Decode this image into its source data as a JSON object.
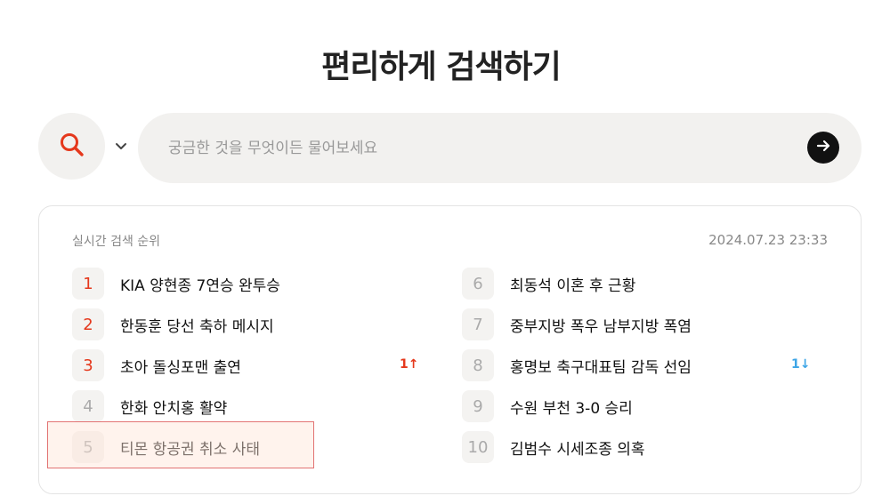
{
  "page": {
    "title": "편리하게 검색하기"
  },
  "search": {
    "placeholder": "궁금한 것을 무엇이든 물어보세요",
    "value": ""
  },
  "colors": {
    "accent_red": "#e5381c",
    "accent_blue": "#3da5e6",
    "bg_soft": "#f2f1ef"
  },
  "trending": {
    "label": "실시간 검색 순위",
    "timestamp": "2024.07.23 23:33",
    "items": [
      {
        "rank": "1",
        "keyword": "KIA 양현종 7연승 완투승",
        "change": ""
      },
      {
        "rank": "2",
        "keyword": "한동훈 당선 축하 메시지",
        "change": ""
      },
      {
        "rank": "3",
        "keyword": "초아 돌싱포맨 출연",
        "change": "1↑"
      },
      {
        "rank": "4",
        "keyword": "한화 안치홍 활약",
        "change": ""
      },
      {
        "rank": "5",
        "keyword": "티몬 항공권 취소 사태",
        "change": ""
      },
      {
        "rank": "6",
        "keyword": "최동석 이혼 후 근황",
        "change": ""
      },
      {
        "rank": "7",
        "keyword": "중부지방 폭우 남부지방 폭염",
        "change": ""
      },
      {
        "rank": "8",
        "keyword": "홍명보 축구대표팀 감독 선임",
        "change": "1↓"
      },
      {
        "rank": "9",
        "keyword": "수원 부천 3-0 승리",
        "change": ""
      },
      {
        "rank": "10",
        "keyword": "김범수 시세조종 의혹",
        "change": ""
      }
    ]
  }
}
